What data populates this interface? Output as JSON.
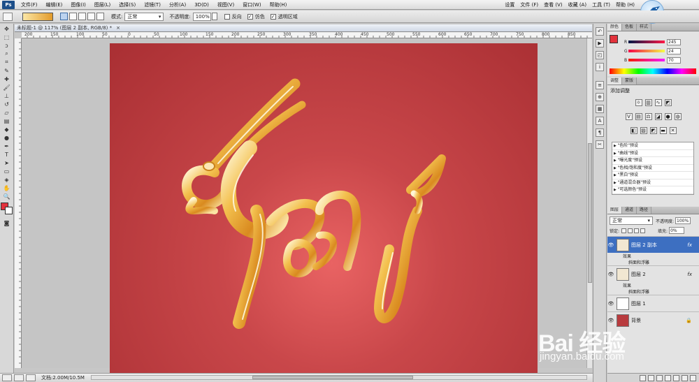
{
  "menubar": {
    "items": [
      "文件(F)",
      "编辑(E)",
      "图像(I)",
      "图层(L)",
      "选择(S)",
      "滤镜(T)",
      "分析(A)",
      "3D(D)",
      "视图(V)",
      "窗口(W)",
      "帮助(H)"
    ],
    "right_items": [
      "设置",
      "文件 (F)",
      "查看 (V)",
      "收藏 (A)",
      "工具 (T)",
      "帮助 (H)"
    ]
  },
  "options": {
    "mode_label": "模式:",
    "mode_value": "正常",
    "opacity_label": "不透明度:",
    "opacity_value": "100%",
    "reverse_label": "反向",
    "dither_label": "仿色",
    "transparency_label": "透明区域"
  },
  "document": {
    "tab_title": "未标题-1 @ 117% (图层 2 副本, RGB/8) *",
    "ruler_numbers": [
      "200",
      "150",
      "100",
      "50",
      "0",
      "50",
      "100",
      "150",
      "200",
      "250",
      "300",
      "350",
      "400",
      "450",
      "500",
      "550",
      "600",
      "650",
      "700",
      "750",
      "800",
      "850"
    ]
  },
  "status": {
    "doc_info": "文档:2.00M/10.5M"
  },
  "color_panel": {
    "tabs": [
      "颜色",
      "色板",
      "样式"
    ],
    "rows": [
      {
        "label": "R",
        "value": "245"
      },
      {
        "label": "G",
        "value": "24"
      },
      {
        "label": "B",
        "value": "70"
      }
    ]
  },
  "adjust_panel": {
    "tabs": [
      "调整",
      "蒙版"
    ],
    "title": "添加调整",
    "presets": [
      "\"色阶\"预设",
      "\"曲线\"预设",
      "\"曝光度\"预设",
      "\"色相/饱和度\"预设",
      "\"黑白\"预设",
      "\"通道混合器\"预设",
      "\"可选颜色\"预设"
    ]
  },
  "layers_panel": {
    "tabs": [
      "图层",
      "通道",
      "路径"
    ],
    "blend_mode": "正常",
    "opacity_label": "不透明度:",
    "opacity_value": "100%",
    "lock_label": "锁定:",
    "fill_label": "填充:",
    "fill_value": "0%",
    "layers": [
      {
        "name": "图层 2 副本",
        "fx": "fx",
        "effects_label": "效果",
        "effect": "斜面和浮雕"
      },
      {
        "name": "图层 2",
        "fx": "fx",
        "effects_label": "效果",
        "effect": "斜面和浮雕"
      },
      {
        "name": "图层 1"
      },
      {
        "name": "背景"
      }
    ]
  },
  "watermark": {
    "brand": "Bai 经验",
    "url": "jingyan.baidu.com"
  },
  "colors": {
    "canvas_bg": "#c9474a",
    "foreground": "#e2323c",
    "selection": "#3d6fc1",
    "gold": "#e8a531"
  }
}
